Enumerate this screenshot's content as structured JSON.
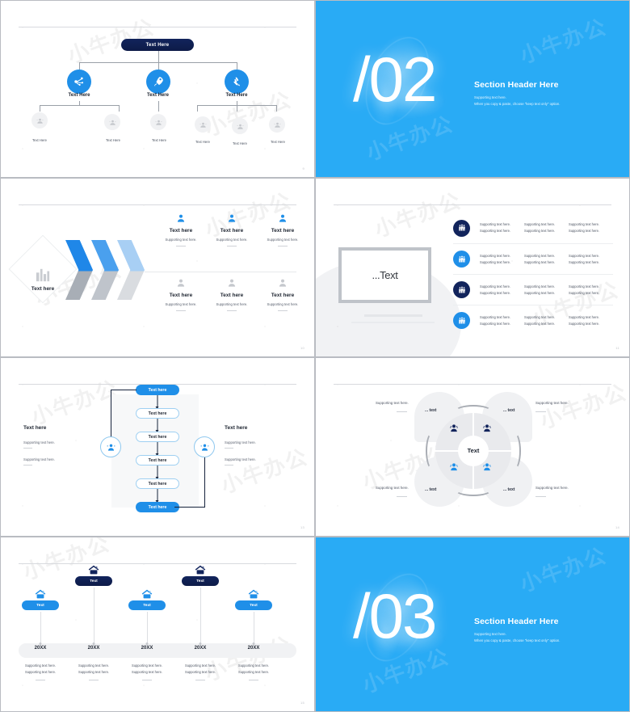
{
  "deck": {
    "slides": [
      {
        "id": "org-chart",
        "page": "9",
        "root": {
          "label": "Text Here"
        },
        "level2": [
          {
            "label": "Text Here",
            "icon": "network-icon"
          },
          {
            "label": "Text Here",
            "icon": "rocket-icon"
          },
          {
            "label": "Text Here",
            "icon": "hand-pen-icon"
          }
        ],
        "level3": [
          {
            "label": "Text Here",
            "icon": "users-icon"
          },
          {
            "label": "Text Here",
            "icon": "users-icon"
          },
          {
            "label": "Text Here",
            "icon": "users-icon"
          },
          {
            "label": "Text Here",
            "icon": "users-icon"
          },
          {
            "label": "Text Here",
            "icon": "users-icon"
          },
          {
            "label": "Text Here",
            "icon": "users-icon"
          }
        ]
      },
      {
        "id": "section-02",
        "number": "/02",
        "title": "Section Header Here",
        "sub1": "Supporting text here.",
        "sub2": "When you copy & paste, choose \"keep text only\" option."
      },
      {
        "id": "chevrons",
        "page": "10",
        "diamond": {
          "label": "Text here",
          "icon": "buildings-icon"
        },
        "items": [
          {
            "title": "Text here",
            "support": "Supporting text here.",
            "icon": "user-icon",
            "tone": "blue"
          },
          {
            "title": "Text here",
            "support": "Supporting text here.",
            "icon": "user-icon",
            "tone": "blue"
          },
          {
            "title": "Text here",
            "support": "Supporting text here.",
            "icon": "user-icon",
            "tone": "blue"
          },
          {
            "title": "Text here",
            "support": "Supporting text here.",
            "icon": "user-icon",
            "tone": "gray"
          },
          {
            "title": "Text here",
            "support": "Supporting text here.",
            "icon": "user-icon",
            "tone": "gray"
          },
          {
            "title": "Text here",
            "support": "Supporting text here.",
            "icon": "user-icon",
            "tone": "gray"
          }
        ]
      },
      {
        "id": "monitor-list",
        "page": "11",
        "monitor": {
          "text": "...Text"
        },
        "rows": [
          {
            "icon": "group-icon",
            "tone": "navy",
            "cols": [
              [
                "Supporting text here.",
                "Supporting text here."
              ],
              [
                "Supporting text here.",
                "Supporting text here."
              ],
              [
                "Supporting text here.",
                "Supporting text here."
              ]
            ]
          },
          {
            "icon": "group-icon",
            "tone": "blue",
            "cols": [
              [
                "Supporting text here.",
                "Supporting text here."
              ],
              [
                "Supporting text here.",
                "Supporting text here."
              ],
              [
                "Supporting text here.",
                "Supporting text here."
              ]
            ]
          },
          {
            "icon": "group-icon",
            "tone": "navy",
            "cols": [
              [
                "Supporting text here.",
                "Supporting text here."
              ],
              [
                "Supporting text here.",
                "Supporting text here."
              ],
              [
                "Supporting text here.",
                "Supporting text here."
              ]
            ]
          },
          {
            "icon": "group-icon",
            "tone": "blue",
            "cols": [
              [
                "Supporting text here.",
                "Supporting text here."
              ],
              [
                "Supporting text here.",
                "Supporting text here."
              ],
              [
                "Supporting text here.",
                "Supporting text here."
              ]
            ]
          }
        ]
      },
      {
        "id": "flow",
        "page": "13",
        "steps": [
          {
            "label": "Text here",
            "style": "filled"
          },
          {
            "label": "Text here",
            "style": "outline"
          },
          {
            "label": "Text here",
            "style": "outline"
          },
          {
            "label": "Text here",
            "style": "outline"
          },
          {
            "label": "Text here",
            "style": "outline"
          },
          {
            "label": "Text here",
            "style": "filled"
          }
        ],
        "left": {
          "title": "Text here",
          "s1": "Supporting text here.",
          "s2": "Supporting text here.",
          "icon": "users-icon"
        },
        "right": {
          "title": "Text here",
          "s1": "Supporting text here.",
          "s2": "Supporting text here.",
          "icon": "users-icon"
        }
      },
      {
        "id": "quad-circle",
        "page": "14",
        "center": "Text",
        "quadrants": [
          {
            "label": "... text",
            "support": "Supporting text here.",
            "icon": "user-icon",
            "tone": "navy"
          },
          {
            "label": "... text",
            "support": "Supporting text here.",
            "icon": "user-icon",
            "tone": "navy"
          },
          {
            "label": "... text",
            "support": "Supporting text here.",
            "icon": "user-icon",
            "tone": "blue"
          },
          {
            "label": "... text",
            "support": "Supporting text here.",
            "icon": "user-icon",
            "tone": "blue"
          }
        ]
      },
      {
        "id": "timeline",
        "page": "15",
        "nodes": [
          {
            "chip": "Text",
            "tone": "lite",
            "year": "20XX",
            "s1": "Supporting text here.",
            "s2": "Supporting text here.",
            "icon": "home-icon"
          },
          {
            "chip": "Text",
            "tone": "dark",
            "year": "20XX",
            "s1": "Supporting text here.",
            "s2": "Supporting text here.",
            "icon": "home-icon"
          },
          {
            "chip": "Text",
            "tone": "lite",
            "year": "20XX",
            "s1": "Supporting text here.",
            "s2": "Supporting text here.",
            "icon": "home-icon"
          },
          {
            "chip": "Text",
            "tone": "dark",
            "year": "20XX",
            "s1": "Supporting text here.",
            "s2": "Supporting text here.",
            "icon": "home-icon"
          },
          {
            "chip": "Text",
            "tone": "lite",
            "year": "20XX",
            "s1": "Supporting text here.",
            "s2": "Supporting text here.",
            "icon": "home-icon"
          }
        ]
      },
      {
        "id": "section-03",
        "number": "/03",
        "title": "Section Header Here",
        "sub1": "Supporting text here.",
        "sub2": "When you copy & paste, choose \"keep text only\" option."
      }
    ]
  },
  "colors": {
    "accent_blue": "#1f8fe8",
    "section_bg": "#29abf5",
    "navy": "#12245c",
    "gray_icon": "#c5c8cd",
    "chevron_blue_1": "#1f87e8",
    "chevron_blue_2": "#4aa0ee",
    "chevron_blue_3": "#a8cff4",
    "chevron_gray_1": "#a8aeb6",
    "chevron_gray_2": "#bfc4cb",
    "chevron_gray_3": "#d9dce0"
  },
  "watermark": {
    "text": "小牛办公"
  }
}
